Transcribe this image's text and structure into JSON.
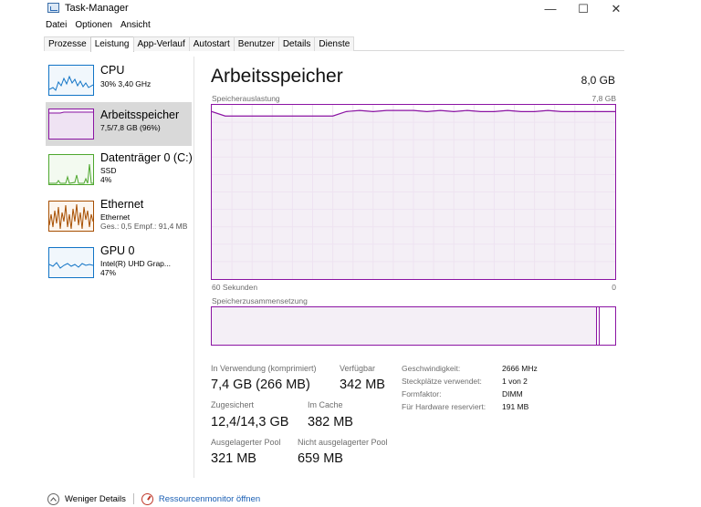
{
  "window": {
    "title": "Task-Manager",
    "minimize": "—",
    "maximize": "☐",
    "close": "✕"
  },
  "menu": [
    "Datei",
    "Optionen",
    "Ansicht"
  ],
  "tabs": [
    "Prozesse",
    "Leistung",
    "App-Verlauf",
    "Autostart",
    "Benutzer",
    "Details",
    "Dienste"
  ],
  "active_tab": "Leistung",
  "sidebar": [
    {
      "title": "CPU",
      "sub1": "30% 3,40 GHz",
      "sub2": "",
      "color": "#1174c6"
    },
    {
      "title": "Arbeitsspeicher",
      "sub1": "7,5/7,8 GB (96%)",
      "sub2": "",
      "color": "#8b14a3"
    },
    {
      "title": "Datenträger 0 (C:)",
      "sub1": "SSD",
      "sub2": "4%",
      "color": "#4ea72e"
    },
    {
      "title": "Ethernet",
      "sub1": "Ethernet",
      "sub2": "Ges.: 0,5 Empf.: 91,4 MB",
      "color": "#a74f01"
    },
    {
      "title": "GPU 0",
      "sub1": "Intel(R) UHD Grap...",
      "sub2": "47%",
      "color": "#1174c6"
    }
  ],
  "main": {
    "title": "Arbeitsspeicher",
    "total": "8,0 GB",
    "usage_label": "Speicherauslastung",
    "usage_max": "7,8 GB",
    "time_left": "60 Sekunden",
    "time_right": "0",
    "composition_label": "Speicherzusammensetzung",
    "in_use_fraction": 0.955,
    "modified_fraction": 0.007
  },
  "stats": {
    "in_use_label": "In Verwendung (komprimiert)",
    "in_use_value": "7,4 GB (266 MB)",
    "available_label": "Verfügbar",
    "available_value": "342 MB",
    "committed_label": "Zugesichert",
    "committed_value": "12,4/14,3 GB",
    "cached_label": "Im Cache",
    "cached_value": "382 MB",
    "paged_label": "Ausgelagerter Pool",
    "paged_value": "321 MB",
    "nonpaged_label": "Nicht ausgelagerter Pool",
    "nonpaged_value": "659 MB"
  },
  "props": {
    "speed_label": "Geschwindigkeit:",
    "speed_value": "2666 MHz",
    "slots_label": "Steckplätze verwendet:",
    "slots_value": "1 von 2",
    "form_label": "Formfaktor:",
    "form_value": "DIMM",
    "reserved_label": "Für Hardware reserviert:",
    "reserved_value": "191 MB"
  },
  "footer": {
    "fewer_details": "Weniger Details",
    "resource_monitor": "Ressourcenmonitor öffnen"
  },
  "chart_data": {
    "type": "line",
    "title": "Speicherauslastung",
    "ylim": [
      0,
      7.8
    ],
    "x": [
      60,
      58,
      56,
      54,
      52,
      50,
      48,
      46,
      44,
      42,
      40,
      38,
      36,
      34,
      32,
      30,
      28,
      26,
      24,
      22,
      20,
      18,
      16,
      14,
      12,
      10,
      8,
      6,
      4,
      2,
      0
    ],
    "series": [
      {
        "values": [
          7.5,
          7.3,
          7.3,
          7.3,
          7.3,
          7.3,
          7.3,
          7.3,
          7.3,
          7.3,
          7.5,
          7.55,
          7.5,
          7.55,
          7.55,
          7.55,
          7.5,
          7.55,
          7.5,
          7.55,
          7.5,
          7.5,
          7.55,
          7.5,
          7.5,
          7.55,
          7.5,
          7.5,
          7.5,
          7.5,
          7.5
        ]
      }
    ],
    "grid": true,
    "color": "#8b14a3"
  }
}
